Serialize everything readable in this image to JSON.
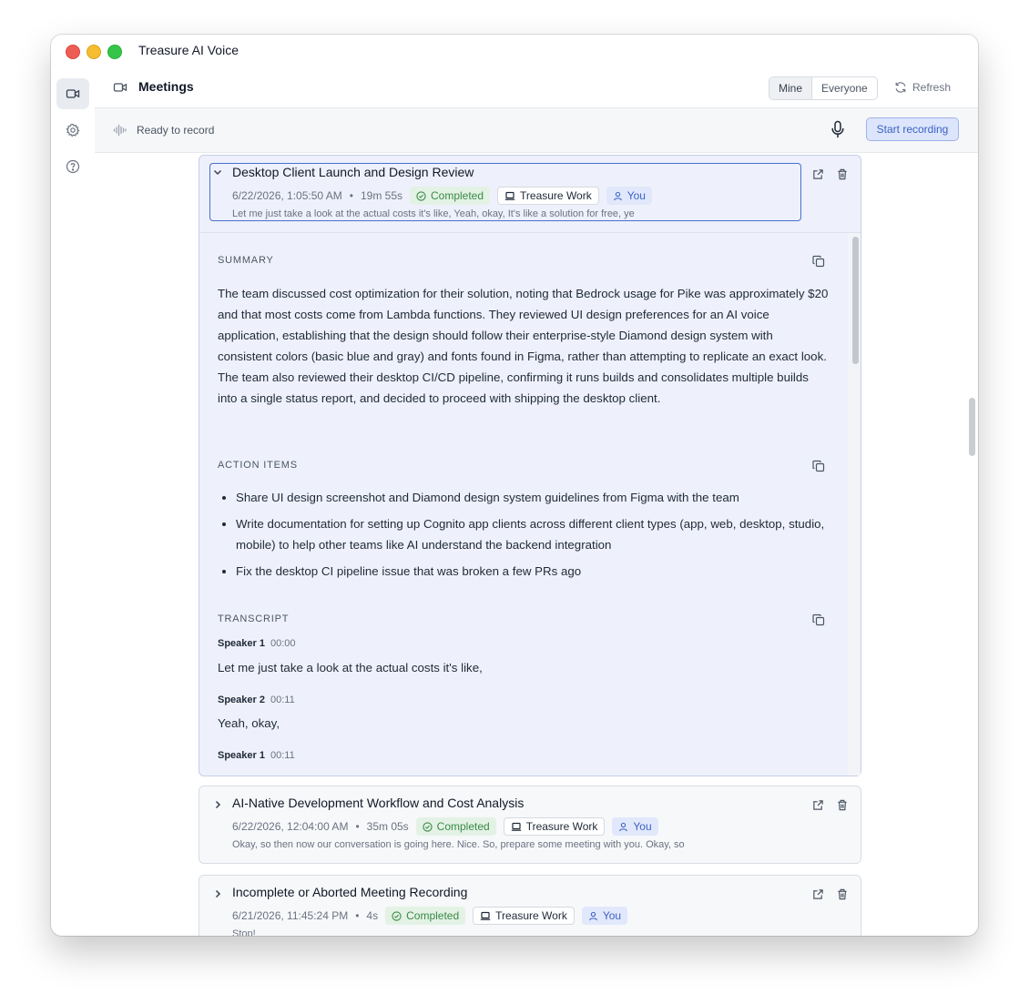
{
  "app": {
    "title": "Treasure AI Voice"
  },
  "sidebar": {
    "items": [
      {
        "icon": "video-icon",
        "active": true
      },
      {
        "icon": "gear-icon",
        "active": false
      },
      {
        "icon": "help-icon",
        "active": false
      }
    ]
  },
  "header": {
    "title": "Meetings",
    "filter_options": [
      "Mine",
      "Everyone"
    ],
    "filter_selected": "Mine",
    "refresh_label": "Refresh"
  },
  "recorder": {
    "status": "Ready to record",
    "start_label": "Start recording"
  },
  "meetings": [
    {
      "title": "Desktop Client Launch and Design Review",
      "datetime": "6/22/2026, 1:05:50 AM",
      "duration": "19m 55s",
      "status": "Completed",
      "workspace": "Treasure Work",
      "owner": "You",
      "snippet": "Let me just take a look at the actual costs it's like, Yeah, okay, It's like a solution for free, ye",
      "expanded": true,
      "summary_label": "SUMMARY",
      "summary": "The team discussed cost optimization for their solution, noting that Bedrock usage for Pike was approximately $20 and that most costs come from Lambda functions. They reviewed UI design preferences for an AI voice application, establishing that the design should follow their enterprise-style Diamond design system with consistent colors (basic blue and gray) and fonts found in Figma, rather than attempting to replicate an exact look. The team also reviewed their desktop CI/CD pipeline, confirming it runs builds and consolidates multiple builds into a single status report, and decided to proceed with shipping the desktop client.",
      "action_items_label": "ACTION ITEMS",
      "action_items": [
        "Share UI design screenshot and Diamond design system guidelines from Figma with the team",
        "Write documentation for setting up Cognito app clients across different client types (app, web, desktop, studio, mobile) to help other teams like AI understand the backend integration",
        "Fix the desktop CI pipeline issue that was broken a few PRs ago"
      ],
      "transcript_label": "TRANSCRIPT",
      "transcript": [
        {
          "speaker": "Speaker 1",
          "time": "00:00",
          "text": "Let me just take a look at the actual costs it's like,"
        },
        {
          "speaker": "Speaker 2",
          "time": "00:11",
          "text": "Yeah, okay,"
        },
        {
          "speaker": "Speaker 1",
          "time": "00:11",
          "text": ""
        }
      ]
    },
    {
      "title": "AI-Native Development Workflow and Cost Analysis",
      "datetime": "6/22/2026, 12:04:00 AM",
      "duration": "35m 05s",
      "status": "Completed",
      "workspace": "Treasure Work",
      "owner": "You",
      "snippet": "Okay, so then now our conversation is going here. Nice. So, prepare some meeting with you. Okay, so",
      "expanded": false
    },
    {
      "title": "Incomplete or Aborted Meeting Recording",
      "datetime": "6/21/2026, 11:45:24 PM",
      "duration": "4s",
      "status": "Completed",
      "workspace": "Treasure Work",
      "owner": "You",
      "snippet": "Stop!",
      "expanded": false
    }
  ]
}
